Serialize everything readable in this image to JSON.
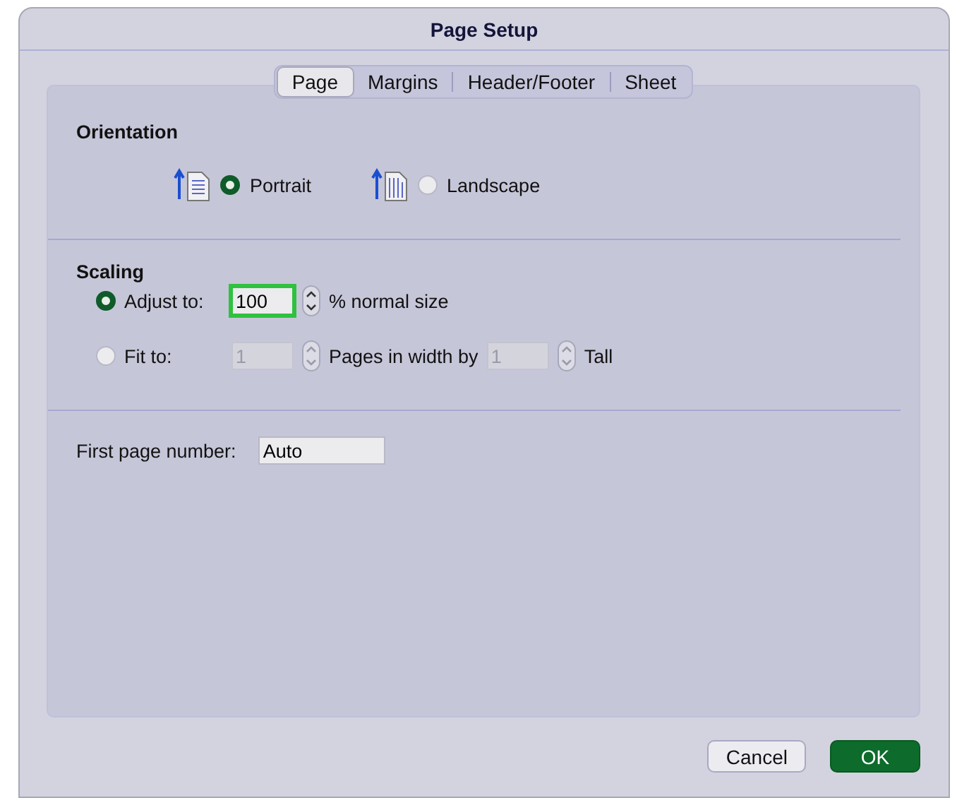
{
  "window": {
    "title": "Page Setup"
  },
  "tabs": [
    {
      "label": "Page",
      "selected": true
    },
    {
      "label": "Margins",
      "selected": false
    },
    {
      "label": "Header/Footer",
      "selected": false
    },
    {
      "label": "Sheet",
      "selected": false
    }
  ],
  "orientation": {
    "heading": "Orientation",
    "options": [
      {
        "kind": "portrait",
        "label": "Portrait",
        "selected": true
      },
      {
        "kind": "landscape",
        "label": "Landscape",
        "selected": false
      }
    ]
  },
  "scaling": {
    "heading": "Scaling",
    "adjust": {
      "label": "Adjust to:",
      "selected": true,
      "value": "100",
      "focused": true,
      "suffix": "% normal size"
    },
    "fit": {
      "label": "Fit to:",
      "selected": false,
      "disabled": true,
      "wide_value": "1",
      "wide_label": "Pages in width by",
      "tall_value": "1",
      "tall_label": "Tall"
    }
  },
  "first_page_number": {
    "label": "First page number:",
    "value": "Auto"
  },
  "buttons": [
    {
      "label": "Cancel",
      "kind": "normal"
    },
    {
      "label": "OK",
      "kind": "default"
    }
  ]
}
